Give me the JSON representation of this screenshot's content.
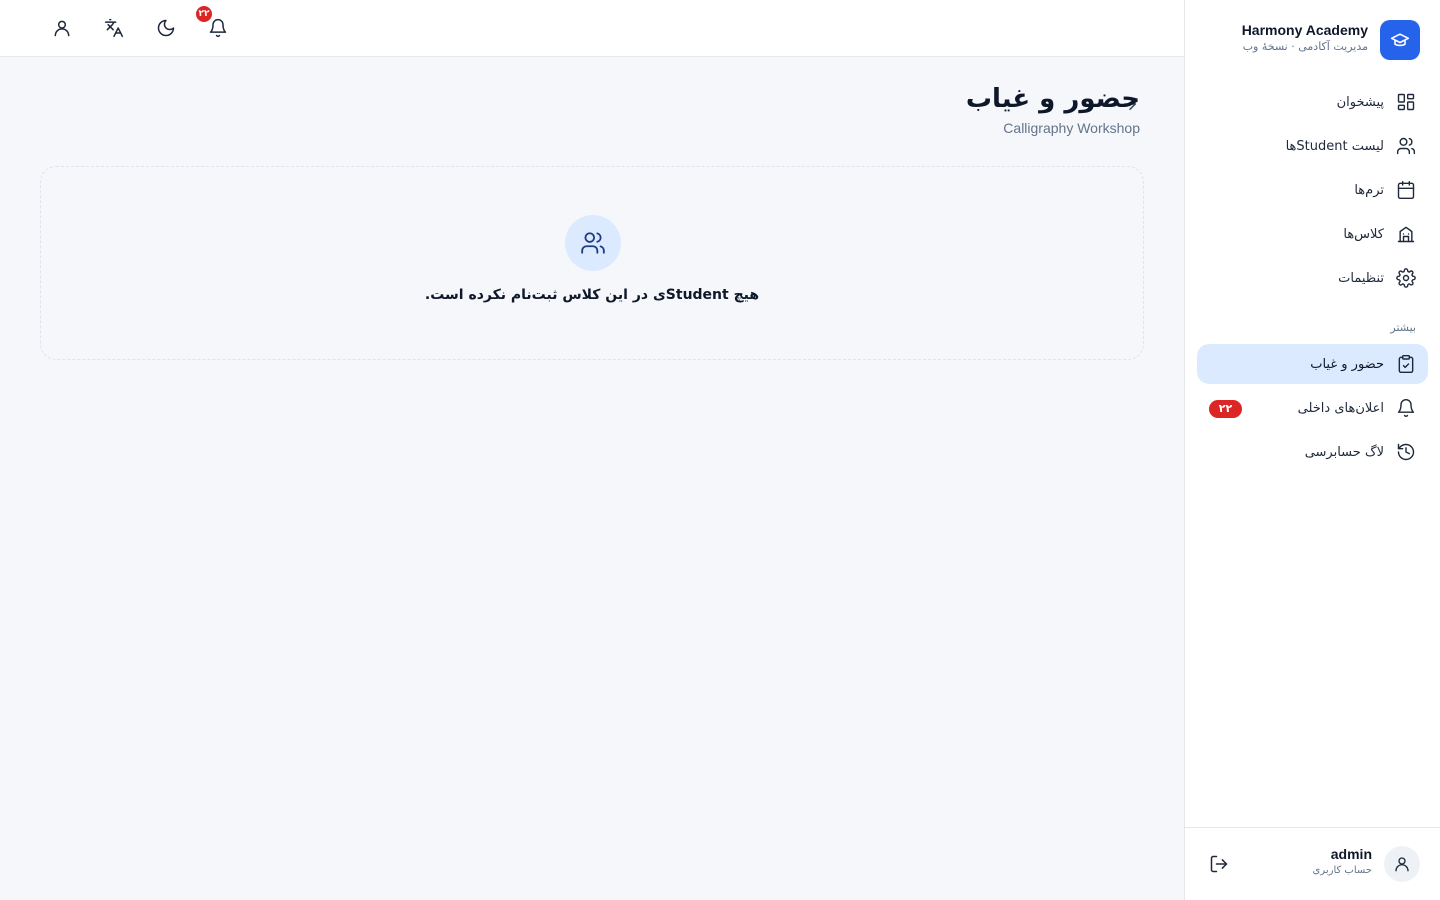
{
  "brand": {
    "title": "Harmony Academy",
    "subtitle": "مدیریت آکادمی · نسخهٔ وب",
    "logo_icon": "graduation-cap-icon",
    "accent_color": "#2563eb"
  },
  "sidebar": {
    "items": [
      {
        "label": "پیشخوان",
        "icon": "dashboard-icon",
        "active": false
      },
      {
        "label": "لیست Studentها",
        "icon": "users-icon",
        "active": false
      },
      {
        "label": "ترم‌ها",
        "icon": "calendar-icon",
        "active": false
      },
      {
        "label": "کلاس‌ها",
        "icon": "building-icon",
        "active": false
      },
      {
        "label": "تنظیمات",
        "icon": "gear-icon",
        "active": false
      }
    ],
    "section_title": "بیشتر",
    "more_items": [
      {
        "label": "حضور و غیاب",
        "icon": "clipboard-check-icon",
        "active": true
      },
      {
        "label": "اعلان‌های داخلی",
        "icon": "bell-icon",
        "badge": "۲۲",
        "active": false
      },
      {
        "label": "لاگ حسابرسی",
        "icon": "history-icon",
        "active": false
      }
    ]
  },
  "user": {
    "name": "admin",
    "role": "حساب کاربری"
  },
  "topbar": {
    "notification_count": "۲۲"
  },
  "page": {
    "title": "حضور و غیاب",
    "subtitle": "Calligraphy Workshop"
  },
  "empty_state": {
    "message": "هیچ Studentی در این کلاس ثبت‌نام نکرده است.",
    "icon": "users-icon"
  },
  "colors": {
    "active_bg": "#dbeafe",
    "badge": "#dc2626",
    "background": "#f5f7fb"
  }
}
